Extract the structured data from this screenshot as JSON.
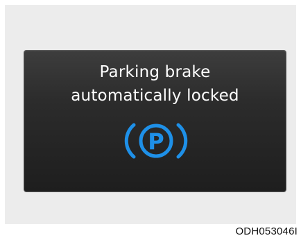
{
  "display": {
    "message_line1": "Parking brake",
    "message_line2": "automatically locked",
    "icon": {
      "name": "parking-brake-icon",
      "letter": "P",
      "color": "#1e90e8"
    }
  },
  "figure_code": "ODH053046I",
  "colors": {
    "background_panel": "#ececec",
    "display_background": "#2a2a2a",
    "message_text": "#ffffff",
    "accent_blue": "#1e90e8"
  }
}
